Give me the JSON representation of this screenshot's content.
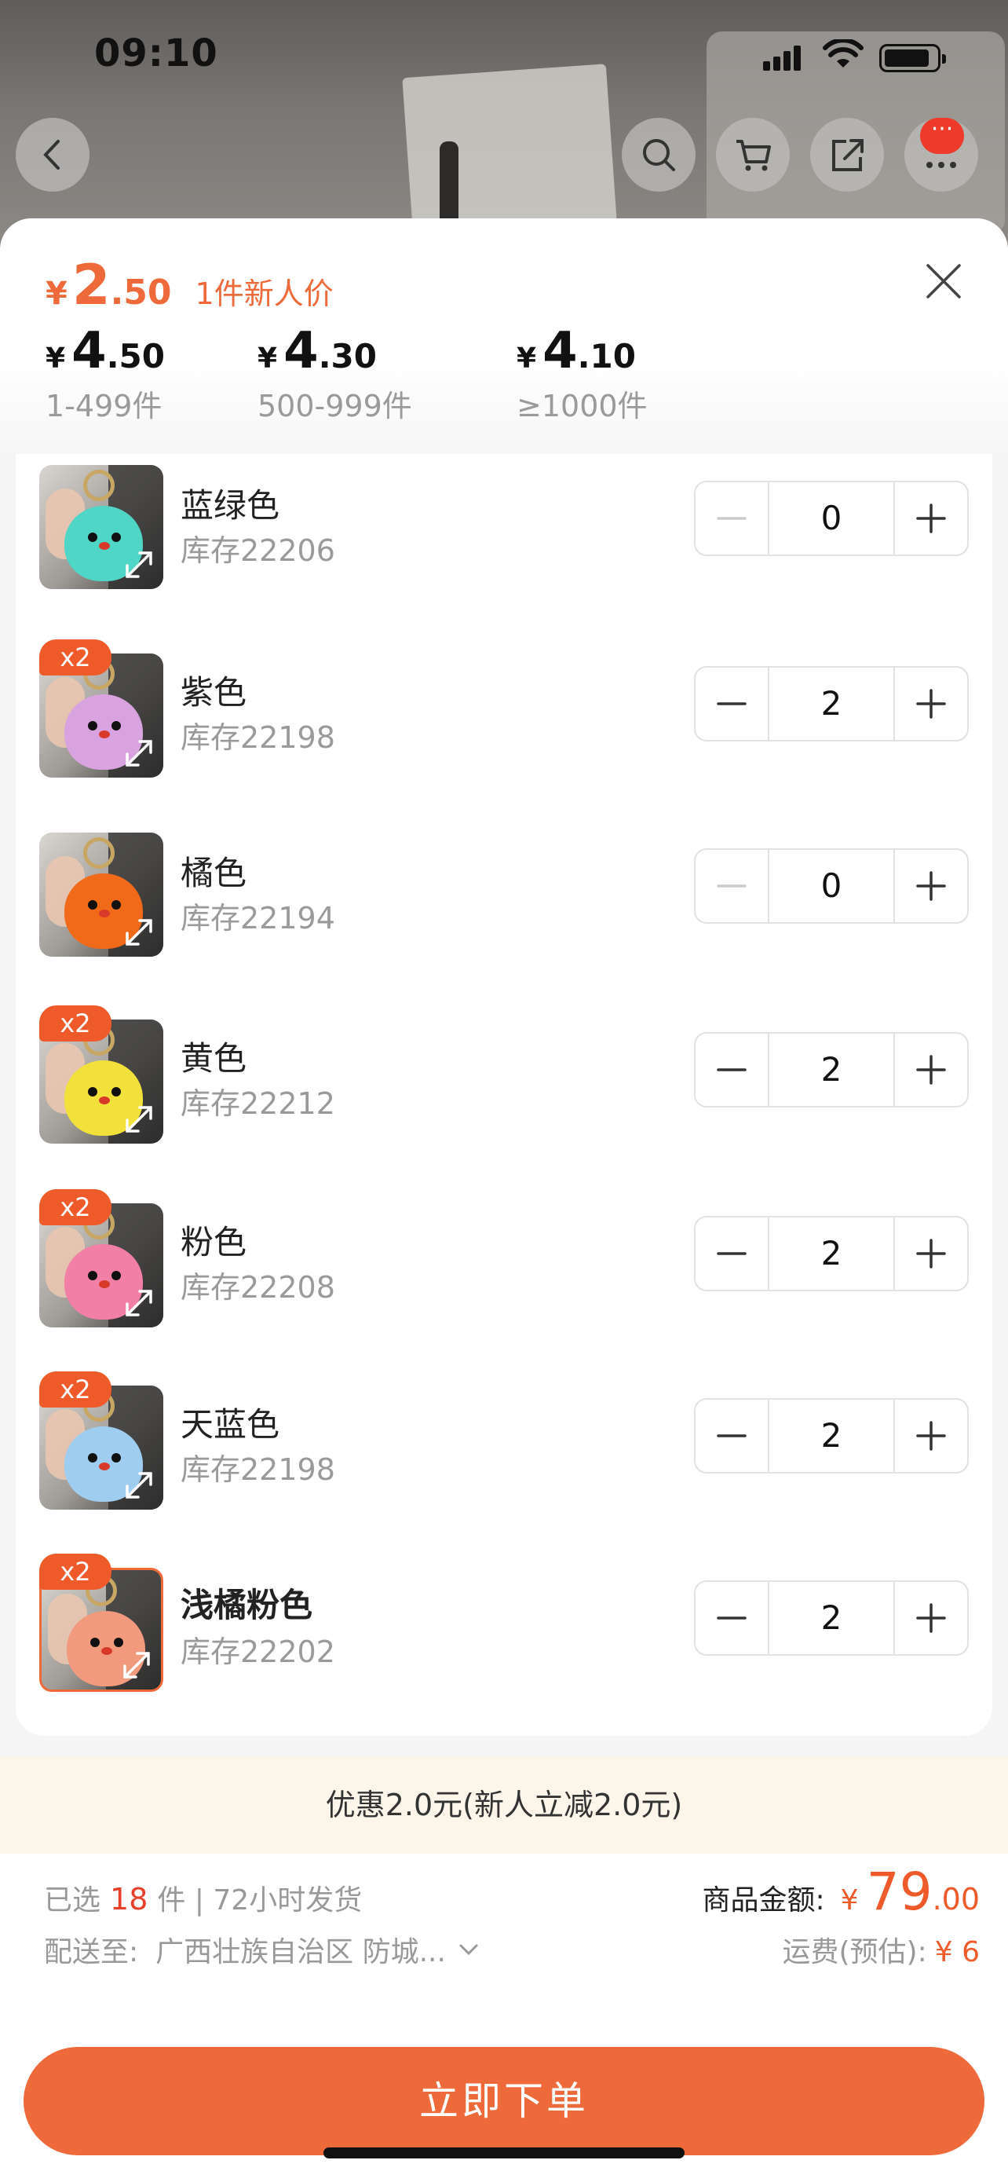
{
  "status_bar": {
    "time": "09:10"
  },
  "header": {
    "price": {
      "currency": "¥",
      "int": "2",
      "dec": ".50",
      "tag": "1件新人价"
    },
    "tiers": [
      {
        "currency": "¥",
        "int": "4",
        "dec": ".50",
        "range": "1-499件"
      },
      {
        "currency": "¥",
        "int": "4",
        "dec": ".30",
        "range": "500-999件"
      },
      {
        "currency": "¥",
        "int": "4",
        "dec": ".10",
        "range": "≥1000件"
      }
    ]
  },
  "items": [
    {
      "name": "蓝绿色",
      "stock": "库存22206",
      "qty": "0",
      "badge": "",
      "color": "#4fd6c6"
    },
    {
      "name": "紫色",
      "stock": "库存22198",
      "qty": "2",
      "badge": "x2",
      "color": "#d9a3e0"
    },
    {
      "name": "橘色",
      "stock": "库存22194",
      "qty": "0",
      "badge": "",
      "color": "#f06a1a"
    },
    {
      "name": "黄色",
      "stock": "库存22212",
      "qty": "2",
      "badge": "x2",
      "color": "#f2e13a"
    },
    {
      "name": "粉色",
      "stock": "库存22208",
      "qty": "2",
      "badge": "x2",
      "color": "#f27fa5"
    },
    {
      "name": "天蓝色",
      "stock": "库存22198",
      "qty": "2",
      "badge": "x2",
      "color": "#9fcdf0"
    },
    {
      "name": "浅橘粉色",
      "stock": "库存22202",
      "qty": "2",
      "badge": "x2",
      "color": "#f29a7e"
    }
  ],
  "discount": "优惠2.0元(新人立减2.0元)",
  "footer": {
    "selected_prefix": "已选",
    "selected_count": "18",
    "selected_suffix": "件 | 72小时发货",
    "ship_label": "配送至:",
    "ship_addr": "广西壮族自治区 防城...",
    "amount_label": "商品金额:",
    "amount_currency": "¥",
    "amount_int": "79",
    "amount_dec": ".00",
    "freight_label": "运费(预估):",
    "freight_value": "¥ 6",
    "order_button": "立即下单"
  },
  "colors": {
    "accent": "#ee6a3a",
    "price_red": "#e8402a",
    "discount_bg": "#fbf5ea"
  }
}
